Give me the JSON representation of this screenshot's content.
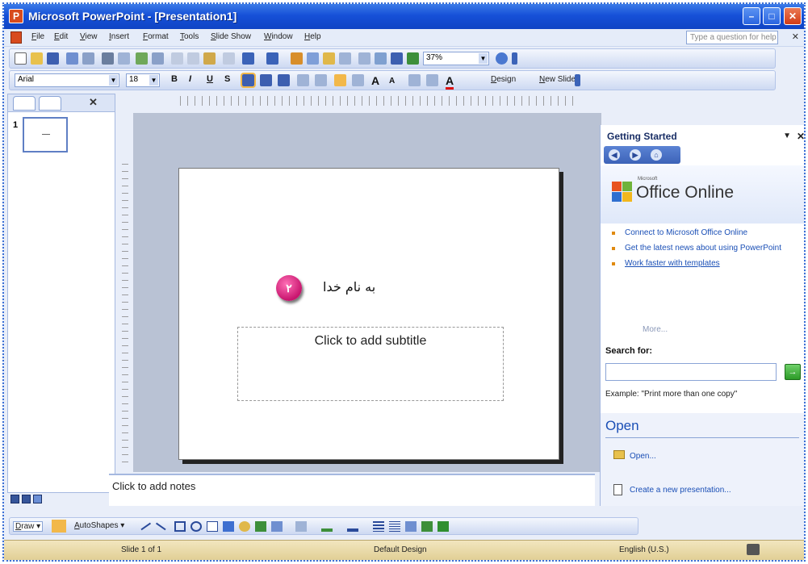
{
  "window": {
    "title": "Microsoft PowerPoint - [Presentation1]",
    "min_label": "–",
    "max_label": "□",
    "close_label": "✕"
  },
  "menu": {
    "items": [
      "File",
      "Edit",
      "View",
      "Insert",
      "Format",
      "Tools",
      "Slide Show",
      "Window",
      "Help"
    ],
    "help_placeholder": "Type a question for help",
    "help_close": "✕"
  },
  "toolbar": {
    "zoom": "37%",
    "font_name": "Arial",
    "font_size": "18",
    "bold": "B",
    "italic": "I",
    "underline": "U",
    "shadow": "S",
    "increase_font": "A",
    "decrease_font": "A",
    "font_color": "A",
    "design_label": "Design",
    "new_slide_label": "New Slide"
  },
  "slides_pane": {
    "close": "✕",
    "slide_number": "1"
  },
  "slide": {
    "bullet_number": "۲",
    "title_text": "به نام خدا",
    "subtitle_placeholder": "Click to add subtitle"
  },
  "notes": {
    "placeholder": "Click to add notes"
  },
  "task_pane": {
    "title": "Getting Started",
    "menu_arrow": "▼",
    "close": "✕",
    "nav": [
      "◀",
      "▶",
      "⌂"
    ],
    "office_online_small": "Microsoft",
    "office_online": "Office Online",
    "links": [
      "Connect to Microsoft Office Online",
      "Get the latest news about using PowerPoint",
      "Work faster with templates"
    ],
    "more": "More...",
    "search_label": "Search for:",
    "search_value": "",
    "search_go": "→",
    "example": "Example: \"Print more than one copy\"",
    "open_title": "Open",
    "open_link": "Open...",
    "create_link": "Create a new presentation..."
  },
  "draw_toolbar": {
    "draw": "Draw ▾",
    "autoshapes": "AutoShapes ▾"
  },
  "status": {
    "slide_of": "Slide 1 of 1",
    "design": "Default Design",
    "language": "English (U.S.)"
  },
  "colors": {
    "titlebar": "#1650d8",
    "accent_pink": "#c8156e",
    "status_bar": "#e1cf95",
    "link_blue": "#1a4fb6"
  }
}
